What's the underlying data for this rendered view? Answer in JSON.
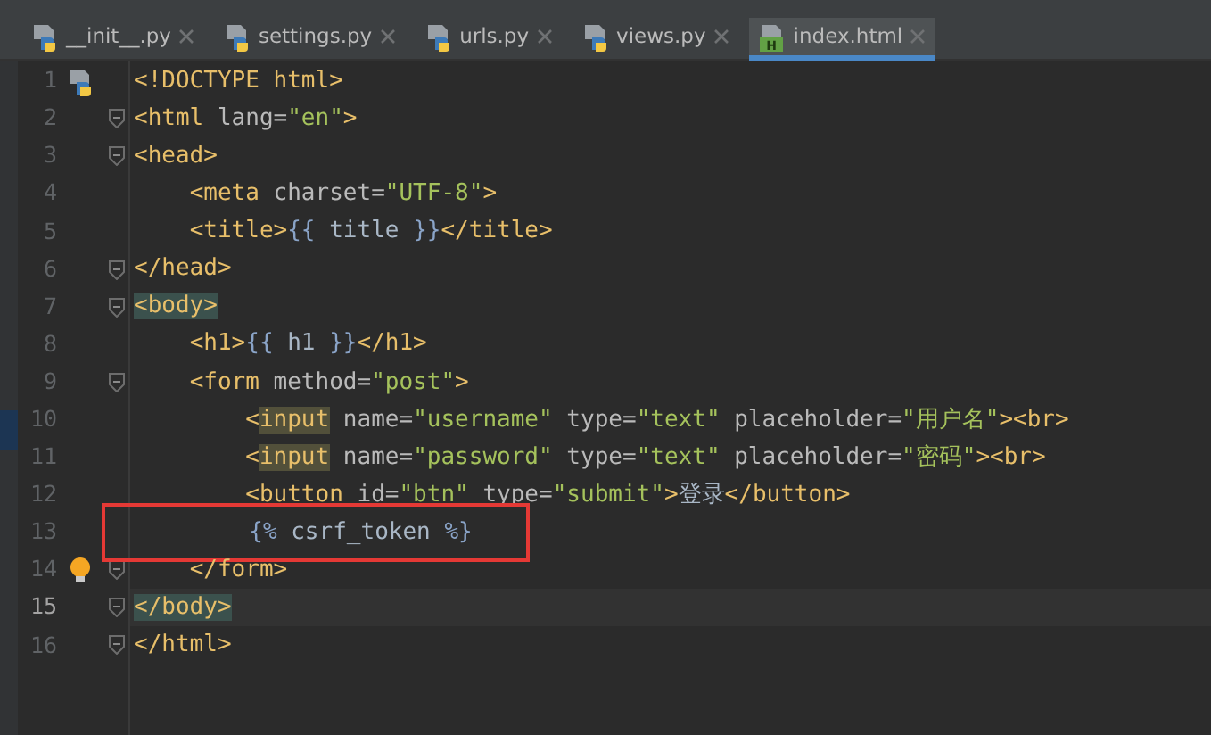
{
  "tabs": [
    {
      "label": "__init__.py",
      "kind": "python",
      "selected": false
    },
    {
      "label": "settings.py",
      "kind": "python",
      "selected": false
    },
    {
      "label": "urls.py",
      "kind": "python",
      "selected": false
    },
    {
      "label": "views.py",
      "kind": "python",
      "selected": false
    },
    {
      "label": "index.html",
      "kind": "html",
      "icon_letter": "H",
      "selected": true
    }
  ],
  "lines": [
    {
      "number": "1",
      "file_icon": true,
      "fold": false,
      "current": false,
      "tokens": [
        {
          "kind": "tag",
          "text": "<!DOCTYPE html>"
        }
      ]
    },
    {
      "number": "2",
      "fold": true,
      "current": false,
      "tokens": [
        {
          "kind": "tag",
          "text": "<html"
        },
        {
          "kind": "attr",
          "text": " lang="
        },
        {
          "kind": "str",
          "text": "\"en\""
        },
        {
          "kind": "tag",
          "text": ">"
        }
      ]
    },
    {
      "number": "3",
      "fold": true,
      "current": false,
      "tokens": [
        {
          "kind": "tag",
          "text": "<head>"
        }
      ],
      "children": [
        {
          "number": "4",
          "fold": false,
          "current": false,
          "tokens": [
            {
              "kind": "tag",
              "text": "<meta"
            },
            {
              "kind": "attr",
              "text": " charset="
            },
            {
              "kind": "str",
              "text": "\"UTF-8\""
            },
            {
              "kind": "tag",
              "text": ">"
            }
          ]
        },
        {
          "number": "5",
          "fold": false,
          "current": false,
          "tokens": [
            {
              "kind": "tag",
              "text": "<title>"
            },
            {
              "kind": "brace",
              "text": "{{"
            },
            {
              "kind": "text",
              "text": " title "
            },
            {
              "kind": "brace",
              "text": "}}"
            },
            {
              "kind": "tag",
              "text": "</title>"
            }
          ]
        }
      ]
    },
    {
      "number": "6",
      "fold": true,
      "current": false,
      "tokens": [
        {
          "kind": "tag",
          "text": "</head>"
        }
      ]
    },
    {
      "number": "7",
      "fold": true,
      "current": false,
      "tokens": [
        {
          "kind": "tag",
          "text": "<body>",
          "highlight": true
        }
      ],
      "children": [
        {
          "number": "8",
          "fold": false,
          "current": false,
          "tokens": [
            {
              "kind": "tag",
              "text": "<h1>"
            },
            {
              "kind": "brace",
              "text": "{{"
            },
            {
              "kind": "text",
              "text": " h1 "
            },
            {
              "kind": "brace",
              "text": "}}"
            },
            {
              "kind": "tag",
              "text": "</h1>"
            }
          ]
        },
        {
          "number": "9",
          "fold": true,
          "current": false,
          "tokens": [
            {
              "kind": "tag",
              "text": "<form"
            },
            {
              "kind": "attr",
              "text": " method="
            },
            {
              "kind": "str",
              "text": "\"post\""
            },
            {
              "kind": "tag",
              "text": ">"
            }
          ],
          "children": [
            {
              "number": "10",
              "fold": false,
              "current": false,
              "tokens": [
                {
                  "kind": "tag",
                  "text": "<"
                },
                {
                  "kind": "tag",
                  "text": "input",
                  "highlight": true
                },
                {
                  "kind": "attr",
                  "text": " name="
                },
                {
                  "kind": "str",
                  "text": "\"username\""
                },
                {
                  "kind": "attr",
                  "text": " type="
                },
                {
                  "kind": "str",
                  "text": "\"text\""
                },
                {
                  "kind": "attr",
                  "text": " placeholder="
                },
                {
                  "kind": "str",
                  "text": "\"用户名\""
                },
                {
                  "kind": "tag",
                  "text": "><br>"
                }
              ]
            },
            {
              "number": "11",
              "fold": false,
              "current": false,
              "tokens": [
                {
                  "kind": "tag",
                  "text": "<"
                },
                {
                  "kind": "tag",
                  "text": "input",
                  "highlight": true
                },
                {
                  "kind": "attr",
                  "text": " name="
                },
                {
                  "kind": "str",
                  "text": "\"password\""
                },
                {
                  "kind": "attr",
                  "text": " type="
                },
                {
                  "kind": "str",
                  "text": "\"text\""
                },
                {
                  "kind": "attr",
                  "text": " placeholder="
                },
                {
                  "kind": "str",
                  "text": "\"密码\""
                },
                {
                  "kind": "tag",
                  "text": "><br>"
                }
              ]
            },
            {
              "number": "12",
              "fold": false,
              "current": false,
              "tokens": [
                {
                  "kind": "tag",
                  "text": "<button"
                },
                {
                  "kind": "attr",
                  "text": " id="
                },
                {
                  "kind": "str",
                  "text": "\"btn\""
                },
                {
                  "kind": "attr",
                  "text": " type="
                },
                {
                  "kind": "str",
                  "text": "\"submit\""
                },
                {
                  "kind": "tag",
                  "text": ">"
                },
                {
                  "kind": "text",
                  "text": "登录"
                },
                {
                  "kind": "tag",
                  "text": "</button>"
                }
              ]
            },
            {
              "number": "13",
              "fold": false,
              "current": false,
              "boxed": true,
              "tokens": [
                {
                  "kind": "brace",
                  "text": "{%"
                },
                {
                  "kind": "text",
                  "text": " csrf_token "
                },
                {
                  "kind": "brace",
                  "text": "%}"
                }
              ]
            }
          ]
        },
        {
          "number": "14",
          "bulb": true,
          "fold": true,
          "current": false,
          "tokens": [
            {
              "kind": "tag",
              "text": "</form>"
            }
          ]
        }
      ]
    },
    {
      "number": "15",
      "fold": true,
      "current": true,
      "tokens": [
        {
          "kind": "tag",
          "text": "</body>",
          "highlight": true
        }
      ]
    },
    {
      "number": "16",
      "fold": true,
      "current": false,
      "tokens": [
        {
          "kind": "tag",
          "text": "</html>"
        }
      ]
    }
  ]
}
